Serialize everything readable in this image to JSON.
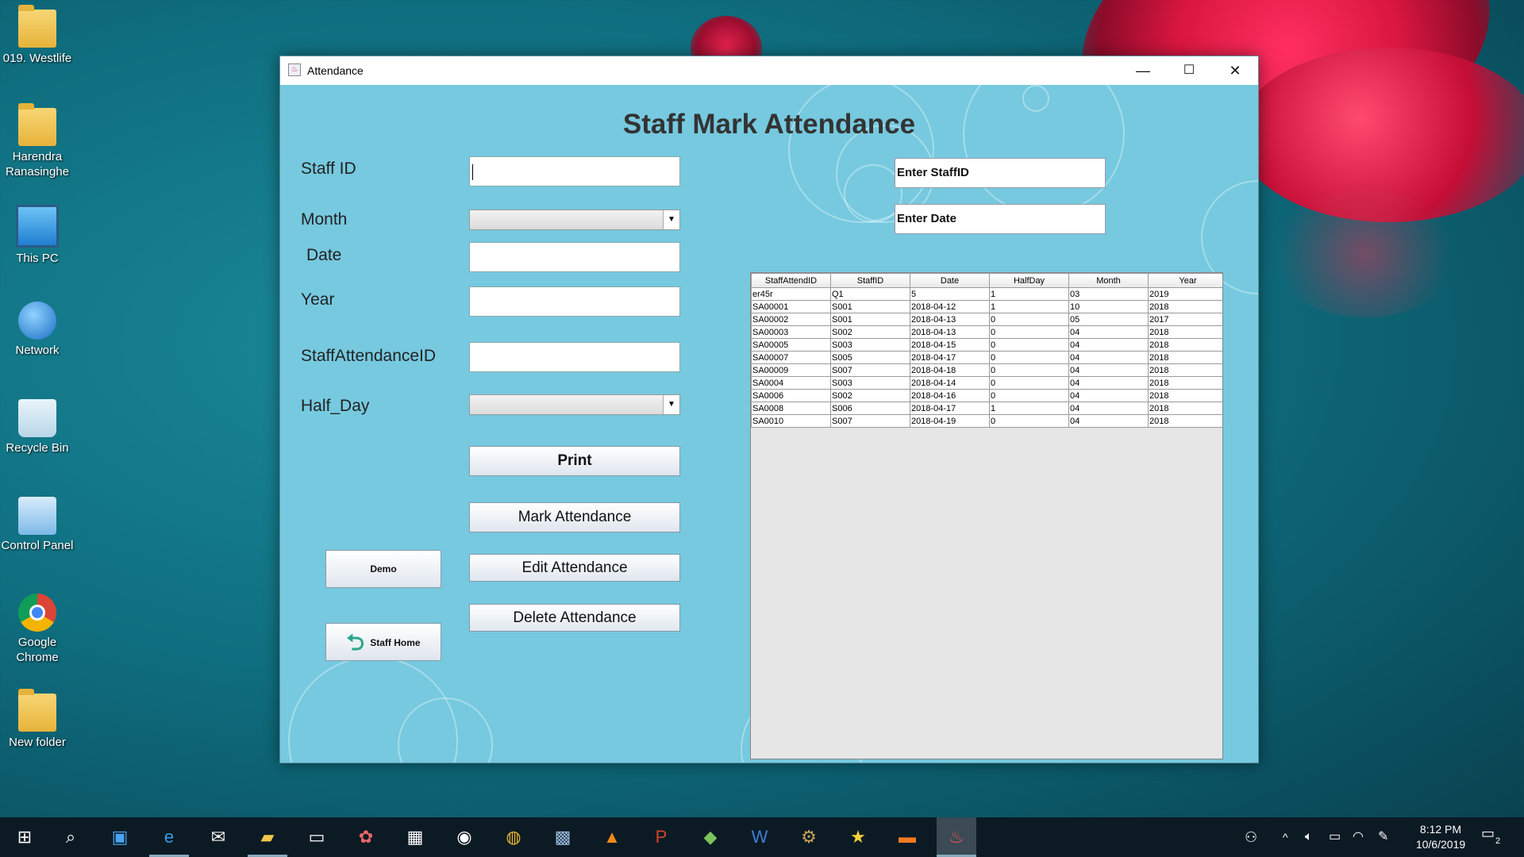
{
  "desktop": {
    "icons": [
      {
        "label": "019. Westlife",
        "icon": "media-folder-icon"
      },
      {
        "label": "Harendra Ranasinghe",
        "icon": "user-folder-icon"
      },
      {
        "label": "This PC",
        "icon": "computer-icon"
      },
      {
        "label": "Network",
        "icon": "network-icon"
      },
      {
        "label": "Recycle Bin",
        "icon": "recycle-bin-icon"
      },
      {
        "label": "Control Panel",
        "icon": "control-panel-icon"
      },
      {
        "label": "Google Chrome",
        "icon": "chrome-icon"
      },
      {
        "label": "New folder",
        "icon": "folder-icon"
      }
    ]
  },
  "window": {
    "title": "Attendance",
    "minimize": "—",
    "maximize": "☐",
    "close": "✕"
  },
  "form": {
    "heading": "Staff Mark Attendance",
    "labels": {
      "staff_id": "Staff ID",
      "month": "Month",
      "date": "Date",
      "year": "Year",
      "staff_attendance_id": "StaffAttendanceID",
      "half_day": "Half_Day"
    },
    "values": {
      "staff_id": "",
      "month": "",
      "date": "",
      "year": "",
      "staff_attendance_id": "",
      "half_day": ""
    },
    "buttons": {
      "print": "Print",
      "mark": "Mark Attendance",
      "edit": "Edit Attendance",
      "delete": "Delete Attendance",
      "demo": "Demo",
      "staff_home": "Staff Home"
    }
  },
  "search": {
    "staff_id_text": "Enter StaffID",
    "date_text": "Enter Date"
  },
  "table": {
    "headers": [
      "StaffAttendID",
      "StaffID",
      "Date",
      "HalfDay",
      "Month",
      "Year"
    ],
    "rows": [
      [
        "er45r",
        "Q1",
        "5",
        "1",
        "03",
        "2019"
      ],
      [
        "SA00001",
        "S001",
        "2018-04-12",
        "1",
        "10",
        "2018"
      ],
      [
        "SA00002",
        "S001",
        "2018-04-13",
        "0",
        "05",
        "2017"
      ],
      [
        "SA00003",
        "S002",
        "2018-04-13",
        "0",
        "04",
        "2018"
      ],
      [
        "SA00005",
        "S003",
        "2018-04-15",
        "0",
        "04",
        "2018"
      ],
      [
        "SA00007",
        "S005",
        "2018-04-17",
        "0",
        "04",
        "2018"
      ],
      [
        "SA00009",
        "S007",
        "2018-04-18",
        "0",
        "04",
        "2018"
      ],
      [
        "SA0004",
        "S003",
        "2018-04-14",
        "0",
        "04",
        "2018"
      ],
      [
        "SA0006",
        "S002",
        "2018-04-16",
        "0",
        "04",
        "2018"
      ],
      [
        "SA0008",
        "S006",
        "2018-04-17",
        "1",
        "04",
        "2018"
      ],
      [
        "SA0010",
        "S007",
        "2018-04-19",
        "0",
        "04",
        "2018"
      ]
    ]
  },
  "taskbar": {
    "clock_time": "8:12 PM",
    "clock_date": "10/6/2019",
    "notification_count": "2"
  }
}
